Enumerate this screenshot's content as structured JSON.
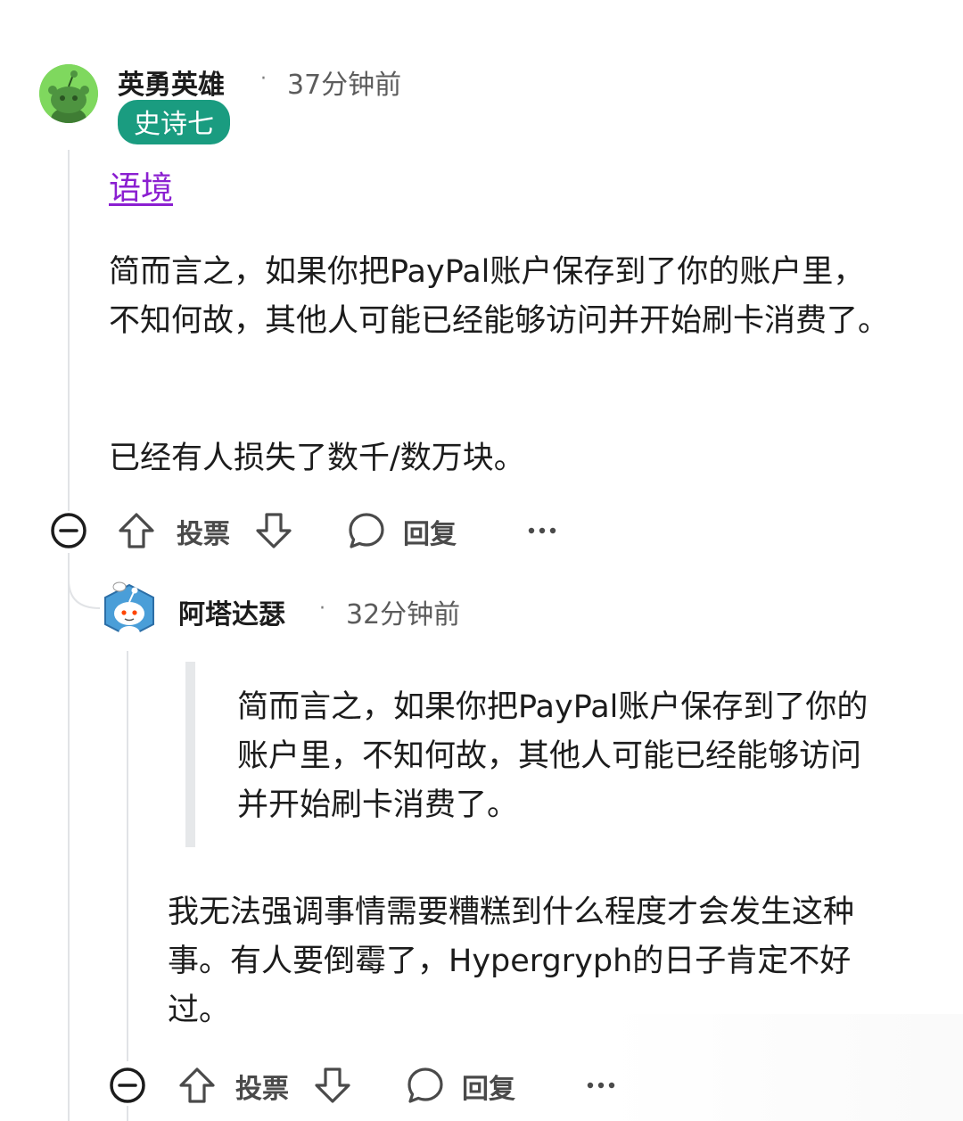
{
  "comment": {
    "username": "英勇英雄",
    "timestamp": "37分钟前",
    "flair": "史诗七",
    "context_link": "语境",
    "paragraphs": [
      "简而言之，如果你把PayPal账户保存到了你的账户里，不知何故，其他人可能已经能够访问并开始刷卡消费了。",
      "已经有人损失了数千/数万块。"
    ],
    "actions": {
      "vote_label": "投票",
      "reply_label": "回复"
    }
  },
  "reply": {
    "username": "阿塔达瑟",
    "timestamp": "32分钟前",
    "quote": "简而言之，如果你把PayPal账户保存到了你的账户里，不知何故，其他人可能已经能够访问并开始刷卡消费了。",
    "paragraph": "我无法强调事情需要糟糕到什么程度才会发生这种事。有人要倒霉了，Hypergryph的日子肯定不好过。",
    "actions": {
      "vote_label": "投票",
      "reply_label": "回复"
    }
  },
  "colors": {
    "flair_bg": "#1a9c80",
    "link": "#8b1fd1",
    "thread_line": "#e1e3e6",
    "avatar1_bg": "#7fd85e"
  }
}
